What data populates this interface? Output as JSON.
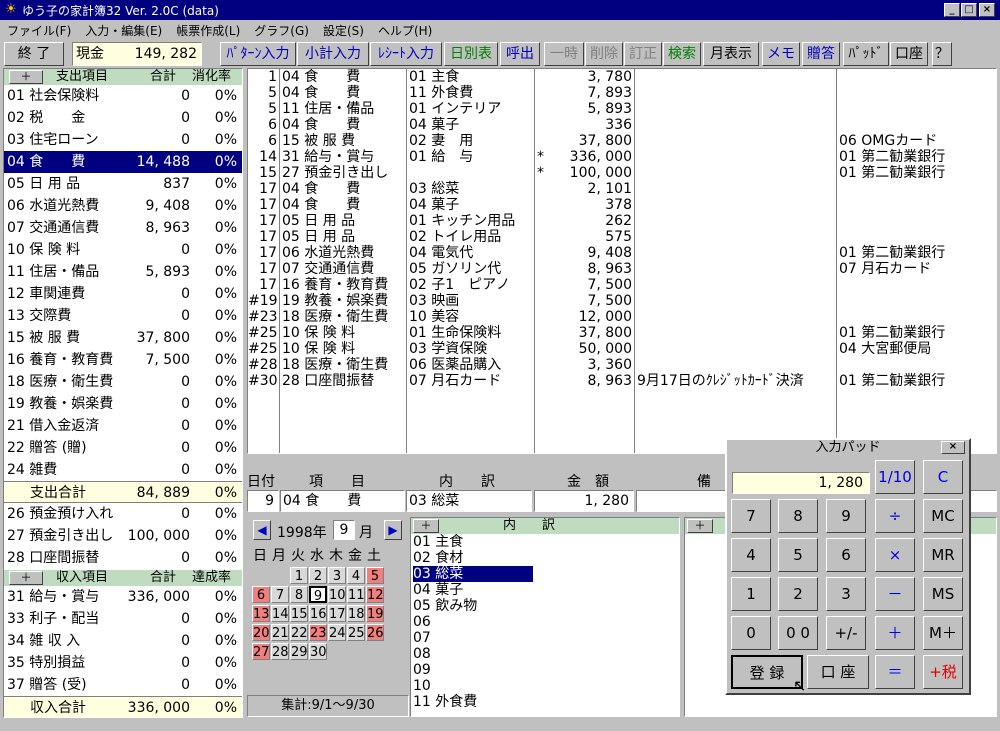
{
  "window": {
    "title": "ゆう子の家計簿32  Ver. 2.0C  (data)"
  },
  "menu": [
    "ファイル(F)",
    "入力・編集(E)",
    "帳票作成(L)",
    "グラフ(G)",
    "設定(S)",
    "ヘルプ(H)"
  ],
  "toolbar": {
    "quit": "終 了",
    "cash_label": "現金",
    "cash_value": "149, 282",
    "pattern": "ﾊﾟﾀｰﾝ入力",
    "subtotal": "小計入力",
    "receipt": "ﾚｼｰﾄ入力",
    "daily": "日別表",
    "recall": "呼出",
    "pause": "一時",
    "delete": "削除",
    "correct": "訂正",
    "search": "検索",
    "monthly": "月表示",
    "memo": "メモ",
    "gift": "贈答",
    "pad": "ﾊﾟｯﾄﾞ",
    "account": "口座",
    "help": "？"
  },
  "expense": {
    "plus": "＋",
    "header_item": "支出項目",
    "header_total": "合計",
    "header_rate": "消化率",
    "rows": [
      {
        "label": "01 社会保険料",
        "amount": "0",
        "pct": "0%"
      },
      {
        "label": "02 税　　金",
        "amount": "0",
        "pct": "0%"
      },
      {
        "label": "03 住宅ローン",
        "amount": "0",
        "pct": "0%"
      },
      {
        "label": "04 食　　費",
        "amount": "14, 488",
        "pct": "0%",
        "selected": true
      },
      {
        "label": "05 日 用 品",
        "amount": "837",
        "pct": "0%"
      },
      {
        "label": "06 水道光熱費",
        "amount": "9, 408",
        "pct": "0%"
      },
      {
        "label": "07 交通通信費",
        "amount": "8, 963",
        "pct": "0%"
      },
      {
        "label": "10 保 険 料",
        "amount": "0",
        "pct": "0%"
      },
      {
        "label": "11 住居・備品",
        "amount": "5, 893",
        "pct": "0%"
      },
      {
        "label": "12 車関連費",
        "amount": "0",
        "pct": "0%"
      },
      {
        "label": "13 交際費",
        "amount": "0",
        "pct": "0%"
      },
      {
        "label": "15 被 服 費",
        "amount": "37, 800",
        "pct": "0%"
      },
      {
        "label": "16 養育・教育費",
        "amount": "7, 500",
        "pct": "0%"
      },
      {
        "label": "18 医療・衛生費",
        "amount": "0",
        "pct": "0%"
      },
      {
        "label": "19 教養・娯楽費",
        "amount": "0",
        "pct": "0%"
      },
      {
        "label": "21 借入金返済",
        "amount": "0",
        "pct": "0%"
      },
      {
        "label": "22 贈答 (贈)",
        "amount": "0",
        "pct": "0%"
      },
      {
        "label": "24 雑費",
        "amount": "0",
        "pct": "0%"
      }
    ],
    "total": {
      "label": "支出合計",
      "amount": "84, 889",
      "pct": "0%"
    },
    "after": [
      {
        "label": "26 預金預け入れ",
        "amount": "0",
        "pct": "0%"
      },
      {
        "label": "27 預金引き出し",
        "amount": "100, 000",
        "pct": "0%"
      },
      {
        "label": "28 口座間振替",
        "amount": "0",
        "pct": "0%"
      }
    ]
  },
  "income": {
    "plus": "＋",
    "header_item": "収入項目",
    "header_total": "合計",
    "header_rate": "達成率",
    "rows": [
      {
        "label": "31 給与・賞与",
        "amount": "336, 000",
        "pct": "0%"
      },
      {
        "label": "33 利子・配当",
        "amount": "0",
        "pct": "0%"
      },
      {
        "label": "34 雑 収 入",
        "amount": "0",
        "pct": "0%"
      },
      {
        "label": "35 特別損益",
        "amount": "0",
        "pct": "0%"
      },
      {
        "label": "37 贈答 (受)",
        "amount": "0",
        "pct": "0%"
      }
    ],
    "total": {
      "label": "収入合計",
      "amount": "336, 000",
      "pct": "0%"
    }
  },
  "ledger": [
    {
      "day": "1",
      "item": "04 食　　費",
      "detail": "01 主食",
      "mark": "",
      "amount": "3, 780",
      "note": "",
      "account": ""
    },
    {
      "day": "5",
      "item": "04 食　　費",
      "detail": "11 外食費",
      "mark": "",
      "amount": "7, 893",
      "note": "",
      "account": ""
    },
    {
      "day": "5",
      "item": "11 住居・備品",
      "detail": "01 インテリア",
      "mark": "",
      "amount": "5, 893",
      "note": "",
      "account": ""
    },
    {
      "day": "6",
      "item": "04 食　　費",
      "detail": "04 菓子",
      "mark": "",
      "amount": "336",
      "note": "",
      "account": ""
    },
    {
      "day": "6",
      "item": "15 被 服 費",
      "detail": "02 妻　用",
      "mark": "",
      "amount": "37, 800",
      "note": "",
      "account": "06 OMGカード"
    },
    {
      "day": "14",
      "item": "31 給与・賞与",
      "detail": "01 給　与",
      "mark": "*",
      "amount": "336, 000",
      "note": "",
      "account": "01 第二勧業銀行"
    },
    {
      "day": "15",
      "item": "27 預金引き出し",
      "detail": "",
      "mark": "*",
      "amount": "100, 000",
      "note": "",
      "account": "01 第二勧業銀行"
    },
    {
      "day": "17",
      "item": "04 食　　費",
      "detail": "03 総菜",
      "mark": "",
      "amount": "2, 101",
      "note": "",
      "account": ""
    },
    {
      "day": "17",
      "item": "04 食　　費",
      "detail": "04 菓子",
      "mark": "",
      "amount": "378",
      "note": "",
      "account": ""
    },
    {
      "day": "17",
      "item": "05 日 用 品",
      "detail": "01 キッチン用品",
      "mark": "",
      "amount": "262",
      "note": "",
      "account": ""
    },
    {
      "day": "17",
      "item": "05 日 用 品",
      "detail": "02 トイレ用品",
      "mark": "",
      "amount": "575",
      "note": "",
      "account": ""
    },
    {
      "day": "17",
      "item": "06 水道光熱費",
      "detail": "04 電気代",
      "mark": "",
      "amount": "9, 408",
      "note": "",
      "account": "01 第二勧業銀行"
    },
    {
      "day": "17",
      "item": "07 交通通信費",
      "detail": "05 ガソリン代",
      "mark": "",
      "amount": "8, 963",
      "note": "",
      "account": "07 月石カード"
    },
    {
      "day": "17",
      "item": "16 養育・教育費",
      "detail": "02 子1　ピアノ",
      "mark": "",
      "amount": "7, 500",
      "note": "",
      "account": ""
    },
    {
      "day": "#19",
      "item": "19 教養・娯楽費",
      "detail": "03 映画",
      "mark": "",
      "amount": "7, 500",
      "note": "",
      "account": ""
    },
    {
      "day": "#23",
      "item": "18 医療・衛生費",
      "detail": "10 美容",
      "mark": "",
      "amount": "12, 000",
      "note": "",
      "account": ""
    },
    {
      "day": "#25",
      "item": "10 保 険 料",
      "detail": "01 生命保険料",
      "mark": "",
      "amount": "37, 800",
      "note": "",
      "account": "01 第二勧業銀行"
    },
    {
      "day": "#25",
      "item": "10 保 険 料",
      "detail": "03 学資保険",
      "mark": "",
      "amount": "50, 000",
      "note": "",
      "account": "04 大宮郵便局"
    },
    {
      "day": "#28",
      "item": "18 医療・衛生費",
      "detail": "06 医薬品購入",
      "mark": "",
      "amount": "3, 360",
      "note": "",
      "account": ""
    },
    {
      "day": "#30",
      "item": "28 口座間振替",
      "detail": "07 月石カード",
      "mark": "",
      "amount": "8, 963",
      "note": "9月17日のｸﾚｼﾞｯﾄｶｰﾄﾞ決済",
      "account": "01 第二勧業銀行"
    }
  ],
  "entry": {
    "h_date": "日付",
    "h_item": "項　　目",
    "h_detail": "内　　訳",
    "h_amount": "金　額",
    "h_note": "備",
    "date": "9",
    "item": "04 食　　費",
    "detail": "03 総菜",
    "amount": "1, 280"
  },
  "calendar": {
    "year": "1998年",
    "month": "9",
    "month_suffix": "月",
    "weekdays": [
      "日",
      "月",
      "火",
      "水",
      "木",
      "金",
      "土"
    ],
    "summary": "集計:9/1～9/30"
  },
  "subcat": {
    "plus": "＋",
    "header": "内　　訳",
    "items": [
      "01 主食",
      "02 食材",
      "03 総菜",
      "04 菓子",
      "05 飲み物",
      "06",
      "07",
      "08",
      "09",
      "10",
      "11 外食費"
    ],
    "selected_index": 2
  },
  "right_pane": {
    "plus": "＋"
  },
  "pad": {
    "title": "入力パッド",
    "close": "×",
    "display": "1, 280",
    "keys": {
      "tenth": "1/10",
      "clear": "C",
      "k7": "7",
      "k8": "8",
      "k9": "9",
      "div": "÷",
      "mc": "MC",
      "k4": "4",
      "k5": "5",
      "k6": "6",
      "mul": "×",
      "mr": "MR",
      "k1": "1",
      "k2": "2",
      "k3": "3",
      "minus": "－",
      "ms": "MS",
      "k0": "0",
      "k00": "0 0",
      "pm": "+/-",
      "plus": "＋",
      "mplus": "M＋",
      "register": "登 録",
      "account": "口 座",
      "eq": "＝",
      "tax": "+税"
    }
  }
}
